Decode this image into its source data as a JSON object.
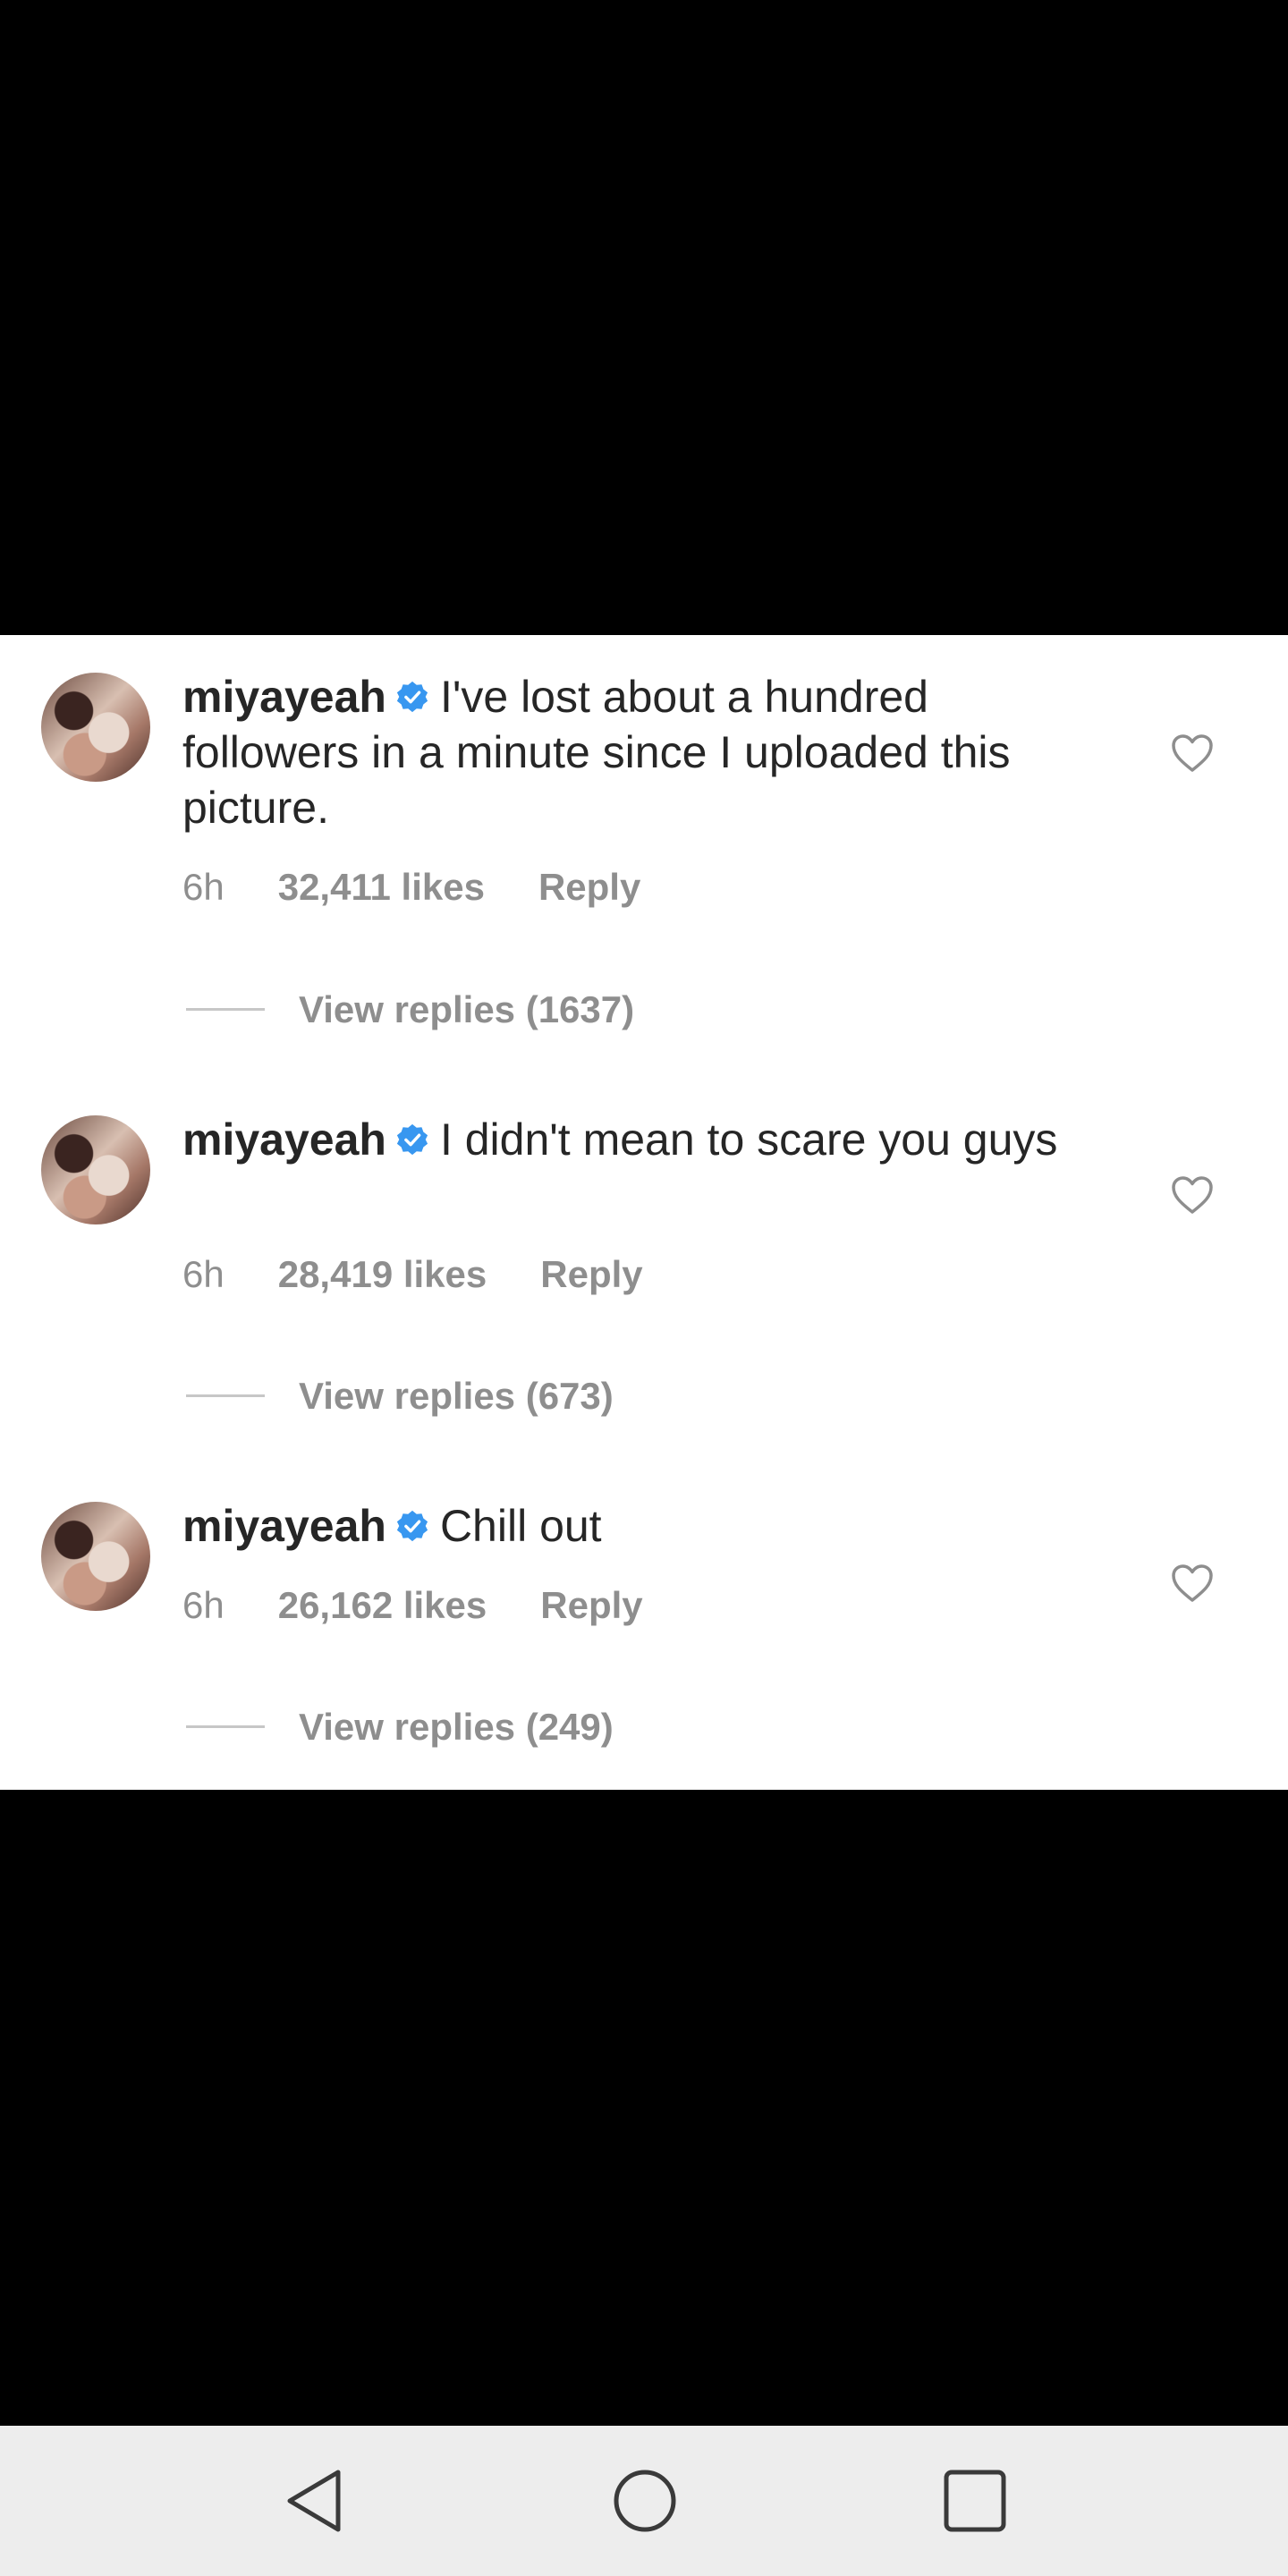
{
  "colors": {
    "text": "#262626",
    "muted": "#8e8e8e",
    "verified": "#3897f0",
    "background_dark": "#000000",
    "navbar": "#ededed"
  },
  "comments": [
    {
      "username": "miyayeah",
      "text": "I've lost about a hundred followers in a minute since I uploaded this picture.",
      "time": "6h",
      "likes": "32,411 likes",
      "reply": "Reply",
      "view_replies": "View replies (1637)"
    },
    {
      "username": "miyayeah",
      "text": "I didn't mean to scare you guys",
      "time": "6h",
      "likes": "28,419 likes",
      "reply": "Reply",
      "view_replies": "View replies (673)"
    },
    {
      "username": "miyayeah",
      "text": "Chill out",
      "time": "6h",
      "likes": "26,162 likes",
      "reply": "Reply",
      "view_replies": "View replies (249)"
    }
  ],
  "icons": {
    "verified": "verified-badge-icon",
    "like": "heart-icon",
    "back": "back-triangle-icon",
    "home": "home-circle-icon",
    "recents": "recents-square-icon"
  }
}
